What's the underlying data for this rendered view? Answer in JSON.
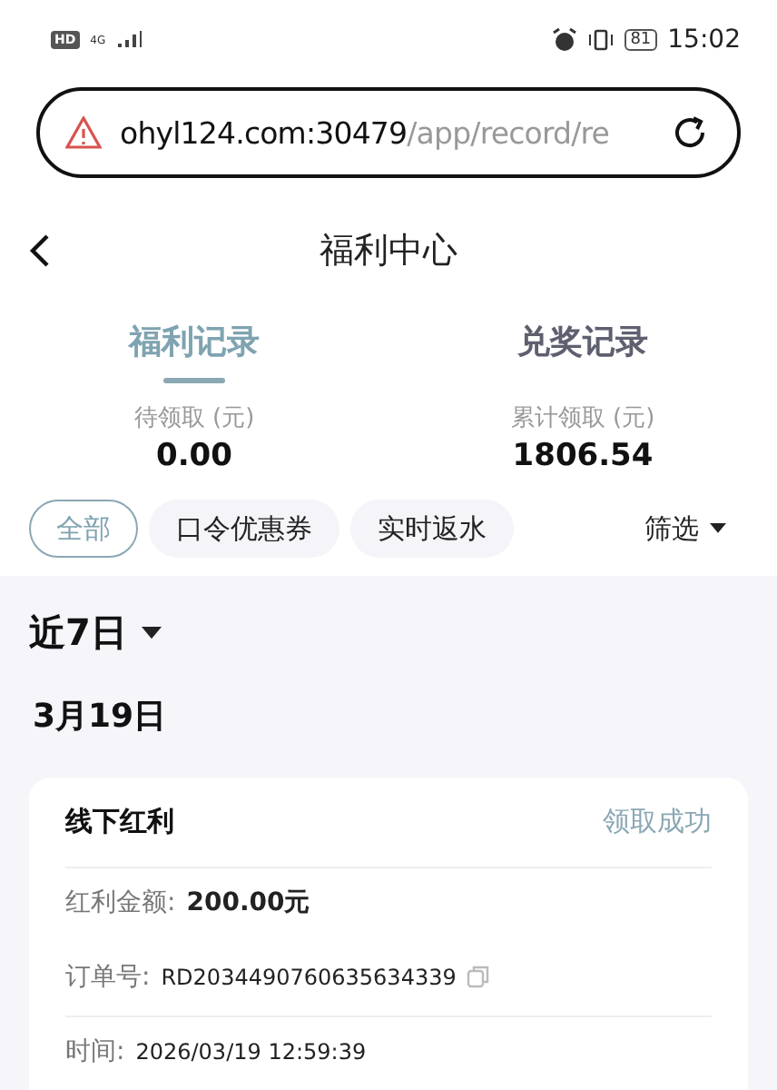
{
  "status_bar": {
    "hd": "HD",
    "network": "4G",
    "battery": "81",
    "time": "15:02"
  },
  "address_bar": {
    "host": "ohyl124.com:30479",
    "path": "/app/record/re"
  },
  "nav": {
    "title": "福利中心"
  },
  "tabs": [
    {
      "label": "福利记录",
      "selected": true
    },
    {
      "label": "兑奖记录",
      "selected": false
    }
  ],
  "stats": [
    {
      "label": "待领取 (元)",
      "value": "0.00"
    },
    {
      "label": "累计领取 (元)",
      "value": "1806.54"
    }
  ],
  "chips": [
    {
      "label": "全部",
      "selected": true
    },
    {
      "label": "口令优惠券",
      "selected": false
    },
    {
      "label": "实时返水",
      "selected": false
    }
  ],
  "filter": "筛选",
  "period": "近7日",
  "date": "3月19日",
  "record": {
    "title": "线下红利",
    "status": "领取成功",
    "amount_label": "红利金额:",
    "amount": "200.00元",
    "order_label": "订单号:",
    "order": "RD2034490760635634339",
    "time_label": "时间:",
    "time": "2026/03/19 12:59:39"
  }
}
